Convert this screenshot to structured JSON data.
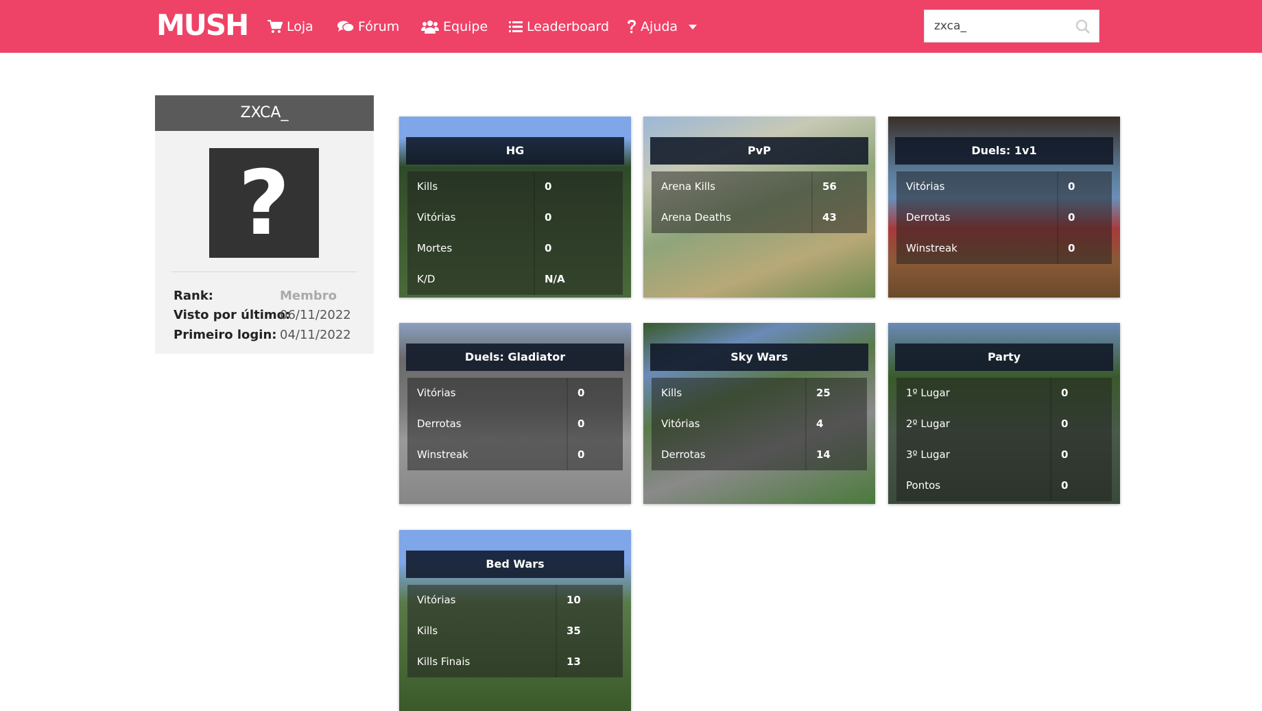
{
  "navbar": {
    "logo": "MUSH",
    "items": [
      {
        "label": "Loja",
        "icon": "cart-icon"
      },
      {
        "label": "Fórum",
        "icon": "comments-icon"
      },
      {
        "label": "Equipe",
        "icon": "users-icon"
      },
      {
        "label": "Leaderboard",
        "icon": "list-icon"
      },
      {
        "label": "Ajuda",
        "icon": "question-icon"
      }
    ],
    "search_value": "zxca_",
    "accent": "#ef4267"
  },
  "profile": {
    "name": "ZXCA_",
    "avatar_glyph": "?",
    "rank_label": "Rank:",
    "rank_value": "Membro",
    "last_seen_label": "Visto por último:",
    "last_seen_value": "06/11/2022",
    "first_login_label": "Primeiro login:",
    "first_login_value": "04/11/2022"
  },
  "cards": [
    {
      "title": "HG",
      "rows": [
        [
          "Kills",
          "0"
        ],
        [
          "Vitórias",
          "0"
        ],
        [
          "Mortes",
          "0"
        ],
        [
          "K/D",
          "N/A"
        ]
      ]
    },
    {
      "title": "PvP",
      "rows": [
        [
          "Arena Kills",
          "56"
        ],
        [
          "Arena Deaths",
          "43"
        ]
      ]
    },
    {
      "title": "Duels: 1v1",
      "rows": [
        [
          "Vitórias",
          "0"
        ],
        [
          "Derrotas",
          "0"
        ],
        [
          "Winstreak",
          "0"
        ]
      ]
    },
    {
      "title": "Duels: Gladiator",
      "rows": [
        [
          "Vitórias",
          "0"
        ],
        [
          "Derrotas",
          "0"
        ],
        [
          "Winstreak",
          "0"
        ]
      ]
    },
    {
      "title": "Sky Wars",
      "rows": [
        [
          "Kills",
          "25"
        ],
        [
          "Vitórias",
          "4"
        ],
        [
          "Derrotas",
          "14"
        ]
      ]
    },
    {
      "title": "Party",
      "rows": [
        [
          "1º Lugar",
          "0"
        ],
        [
          "2º Lugar",
          "0"
        ],
        [
          "3º Lugar",
          "0"
        ],
        [
          "Pontos",
          "0"
        ]
      ]
    },
    {
      "title": "Bed Wars",
      "rows": [
        [
          "Vitórias",
          "10"
        ],
        [
          "Kills",
          "35"
        ],
        [
          "Kills Finais",
          "13"
        ]
      ]
    }
  ]
}
